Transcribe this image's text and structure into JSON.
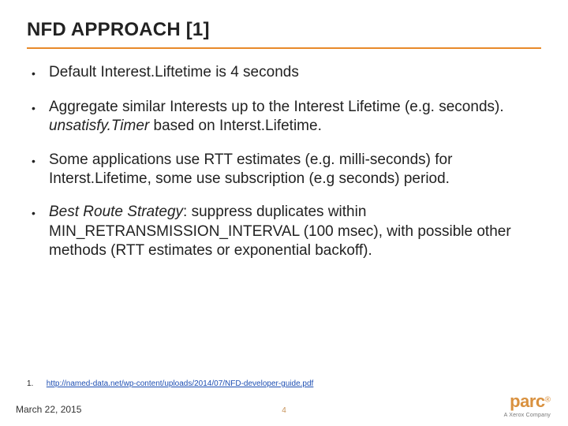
{
  "title": "NFD APPROACH [1]",
  "bullets": [
    {
      "pre": "Default Interest.Liftetime is 4 seconds",
      "em": "",
      "post": ""
    },
    {
      "pre": "Aggregate similar Interests up to the Interest Lifetime (e.g. seconds).  ",
      "em": "unsatisfy.Timer",
      "post": " based on Interst.Lifetime."
    },
    {
      "pre": "Some applications use RTT estimates (e.g. milli-seconds) for Interst.Lifetime, some use subscription (e.g seconds) period.",
      "em": "",
      "post": ""
    },
    {
      "pre": "",
      "em": "Best Route Strategy",
      "post": ": suppress duplicates within MIN_RETRANSMISSION_INTERVAL (100 msec), with possible other methods (RTT estimates or exponential backoff)."
    }
  ],
  "reference": {
    "num": "1.",
    "url": "http://named-data.net/wp-content/uploads/2014/07/NFD-developer-guide.pdf"
  },
  "date": "March 22, 2015",
  "page_number": "4",
  "logo": {
    "main": "parc",
    "reg": "®",
    "sub": "A Xerox Company"
  },
  "colors": {
    "accent": "#e88a2a",
    "logo": "#d9913f",
    "link": "#1e4fb3"
  }
}
